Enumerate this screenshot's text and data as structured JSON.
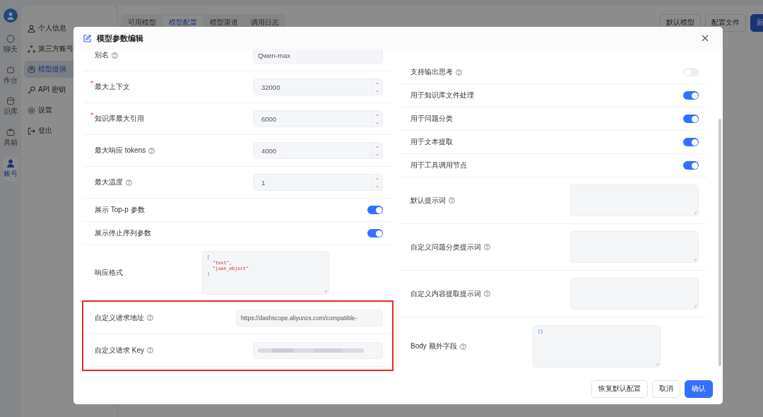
{
  "app_rail": {
    "items": [
      {
        "label": "聊天",
        "selected": false
      },
      {
        "label": "作台",
        "selected": false
      },
      {
        "label": "识库",
        "selected": false
      },
      {
        "label": "具箱",
        "selected": false
      },
      {
        "label": "账号",
        "selected": true
      }
    ]
  },
  "sidebar": {
    "items": [
      {
        "label": "个人信息",
        "selected": false
      },
      {
        "label": "第三方账号",
        "selected": false
      },
      {
        "label": "模型提供",
        "selected": true
      },
      {
        "label": "API 密钥",
        "selected": false
      },
      {
        "label": "设置",
        "selected": false
      },
      {
        "label": "登出",
        "selected": false
      }
    ]
  },
  "tabs": [
    {
      "label": "可用模型",
      "selected": false
    },
    {
      "label": "模型配置",
      "selected": true
    },
    {
      "label": "模型渠道",
      "selected": false
    },
    {
      "label": "调用日志",
      "selected": false
    }
  ],
  "toolbar_buttons": [
    {
      "label": "默认模型",
      "kind": "default"
    },
    {
      "label": "配置文件",
      "kind": "default"
    },
    {
      "label": "新",
      "kind": "primary"
    }
  ],
  "dialog": {
    "title": "模型参数编辑",
    "left_fields": [
      {
        "kind": "text",
        "label": "别名",
        "help": true,
        "value": "Qwen-max"
      },
      {
        "kind": "number",
        "label": "最大上下文",
        "required_mark": "*",
        "value": "32000"
      },
      {
        "kind": "number",
        "label": "知识库最大引用",
        "required_mark": "*",
        "value": "6000"
      },
      {
        "kind": "number",
        "label": "最大响应 tokens",
        "help": true,
        "value": "4000"
      },
      {
        "kind": "number",
        "label": "最大温度",
        "help": true,
        "value": "1"
      },
      {
        "kind": "switch",
        "label": "展示 Top-p 参数",
        "on": true
      },
      {
        "kind": "switch",
        "label": "展示停止序列参数",
        "on": true
      },
      {
        "kind": "code",
        "label": "响应格式",
        "lines": [
          {
            "kind": "bracket",
            "text": "["
          },
          {
            "kind": "string",
            "text": "  \"text\","
          },
          {
            "kind": "string",
            "text": "  \"json_object\""
          },
          {
            "kind": "bracket",
            "text": "]"
          }
        ]
      },
      {
        "kind": "text",
        "label": "自定义请求地址",
        "help": true,
        "value": "https://dashscope.aliyuncs.com/compatible-",
        "highlighted": true
      },
      {
        "kind": "secret",
        "label": "自定义请求 Key",
        "help": true,
        "highlighted": true
      }
    ],
    "right_fields": [
      {
        "kind": "switch",
        "label": "支持输出思考",
        "help": true,
        "on": false
      },
      {
        "kind": "switch",
        "label": "用于知识库文件处理",
        "on": true
      },
      {
        "kind": "switch",
        "label": "用于问题分类",
        "on": true
      },
      {
        "kind": "switch",
        "label": "用于文本提取",
        "on": true
      },
      {
        "kind": "switch",
        "label": "用于工具调用节点",
        "on": true
      },
      {
        "kind": "textarea",
        "label": "默认提示词",
        "help": true
      },
      {
        "kind": "textarea",
        "label": "自定义问题分类提示词",
        "help": true
      },
      {
        "kind": "textarea",
        "label": "自定义内容提取提示词",
        "help": true
      },
      {
        "kind": "code",
        "label": "Body 额外字段",
        "help": true,
        "lines": [
          {
            "kind": "bracket",
            "text": "{}"
          }
        ]
      }
    ],
    "buttons": [
      {
        "label": "恢复默认配置",
        "kind": "default"
      },
      {
        "label": "取消",
        "kind": "default"
      },
      {
        "label": "确认",
        "kind": "primary"
      }
    ]
  }
}
